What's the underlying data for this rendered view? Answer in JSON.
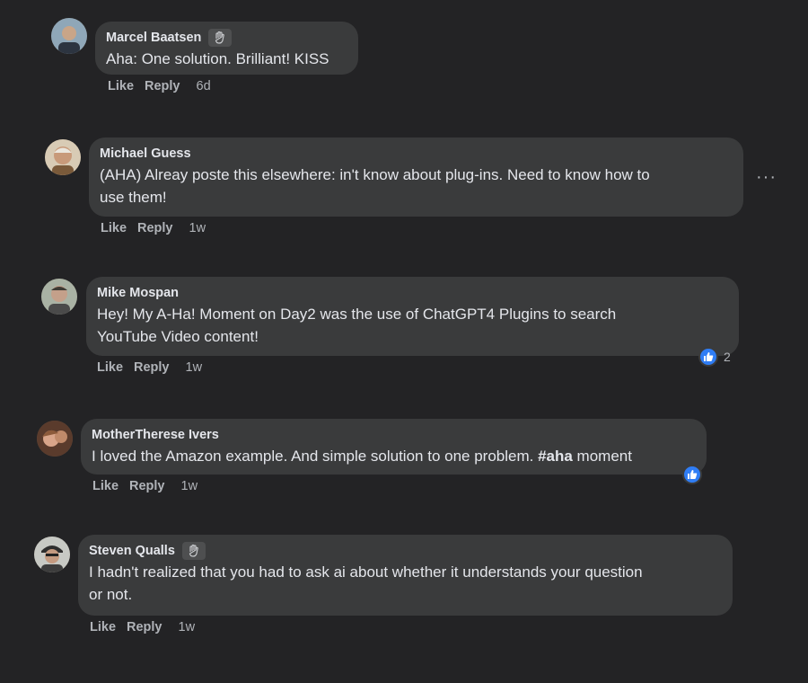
{
  "comments": [
    {
      "name": "Marcel Baatsen",
      "badge": "wave-icon",
      "text": "Aha: One solution. Brilliant! KISS",
      "like": "Like",
      "reply": "Reply",
      "time": "6d"
    },
    {
      "name": "Michael Guess",
      "text_lines": [
        "(AHA) Alreay poste this elsewhere: in't know about plug-ins. Need to know how to",
        "use them!"
      ],
      "like": "Like",
      "reply": "Reply",
      "time": "1w"
    },
    {
      "name": "Mike Mospan",
      "text_lines": [
        "Hey! My A-Ha! Moment on Day2 was the use of ChatGPT4 Plugins to search",
        "YouTube Video content!"
      ],
      "like": "Like",
      "reply": "Reply",
      "time": "1w",
      "reaction_count": "2"
    },
    {
      "name": "MotherTherese Ivers",
      "text_pre": "I loved the Amazon example. And simple solution to one problem. ",
      "hashtag": "#aha",
      "text_post": " moment",
      "like": "Like",
      "reply": "Reply",
      "time": "1w"
    },
    {
      "name": "Steven Qualls",
      "badge": "wave-icon",
      "text_lines": [
        "I hadn't realized that you had to ask ai about whether it understands your question",
        "or not."
      ],
      "like": "Like",
      "reply": "Reply",
      "time": "1w"
    }
  ],
  "colors": {
    "background": "#232325",
    "bubble": "#3a3b3c",
    "text": "#e4e6eb",
    "muted": "#b0b3b8",
    "like_blue": "#2f7df5"
  },
  "more_options": "···"
}
